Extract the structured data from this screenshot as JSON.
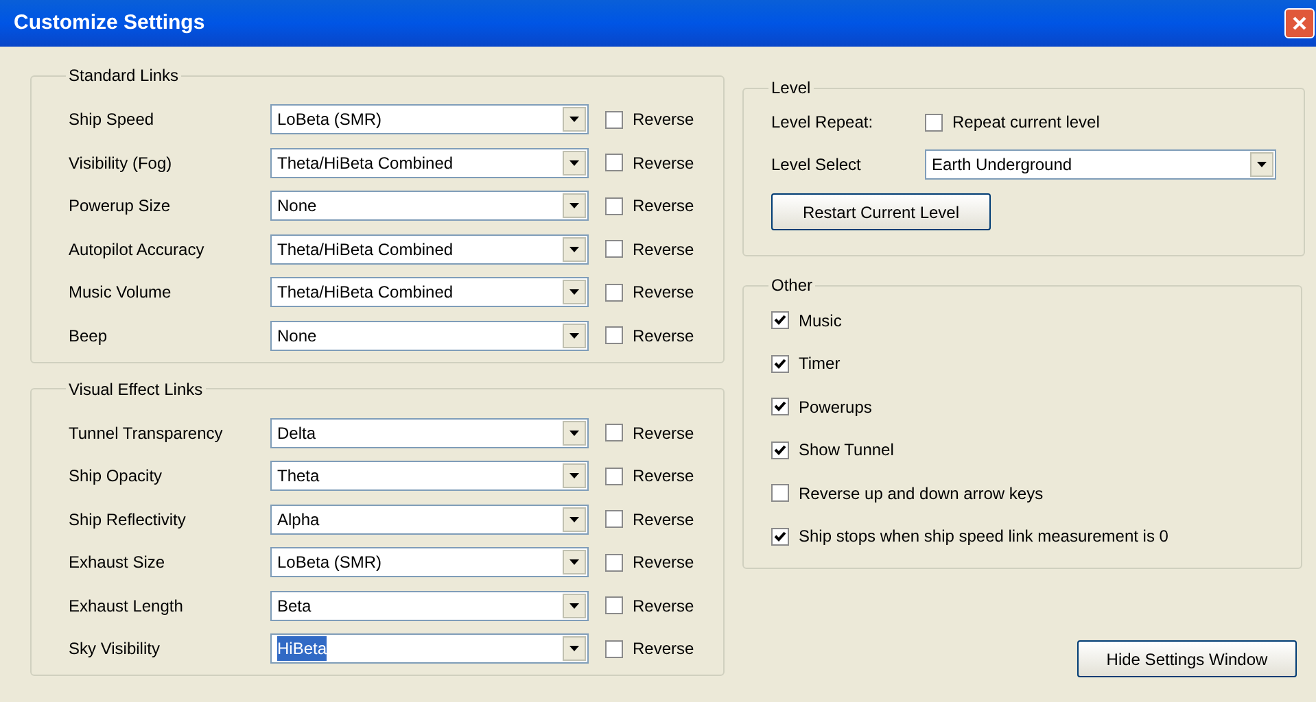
{
  "window": {
    "title": "Customize Settings"
  },
  "groups": [
    {
      "title": "Standard Links",
      "rows": [
        {
          "label": "Ship Speed",
          "value": "LoBeta (SMR)",
          "value_selected": false,
          "reverse_label": "Reverse",
          "reverse": false
        },
        {
          "label": "Visibility (Fog)",
          "value": "Theta/HiBeta Combined",
          "value_selected": false,
          "reverse_label": "Reverse",
          "reverse": false
        },
        {
          "label": "Powerup Size",
          "value": "None",
          "value_selected": false,
          "reverse_label": "Reverse",
          "reverse": false
        },
        {
          "label": "Autopilot Accuracy",
          "value": "Theta/HiBeta Combined",
          "value_selected": false,
          "reverse_label": "Reverse",
          "reverse": false
        },
        {
          "label": "Music Volume",
          "value": "Theta/HiBeta Combined",
          "value_selected": false,
          "reverse_label": "Reverse",
          "reverse": false
        },
        {
          "label": "Beep",
          "value": "None",
          "value_selected": false,
          "reverse_label": "Reverse",
          "reverse": false
        }
      ]
    },
    {
      "title": "Visual Effect Links",
      "rows": [
        {
          "label": "Tunnel Transparency",
          "value": "Delta",
          "value_selected": false,
          "reverse_label": "Reverse",
          "reverse": false
        },
        {
          "label": "Ship Opacity",
          "value": "Theta",
          "value_selected": false,
          "reverse_label": "Reverse",
          "reverse": false
        },
        {
          "label": "Ship Reflectivity",
          "value": "Alpha",
          "value_selected": false,
          "reverse_label": "Reverse",
          "reverse": false
        },
        {
          "label": "Exhaust Size",
          "value": "LoBeta (SMR)",
          "value_selected": false,
          "reverse_label": "Reverse",
          "reverse": false
        },
        {
          "label": "Exhaust Length",
          "value": "Beta",
          "value_selected": false,
          "reverse_label": "Reverse",
          "reverse": false
        },
        {
          "label": "Sky Visibility",
          "value": "HiBeta",
          "value_selected": true,
          "reverse_label": "Reverse",
          "reverse": false
        }
      ]
    }
  ],
  "level": {
    "title": "Level",
    "repeat_label": "Level Repeat:",
    "repeat_checkbox": {
      "label": "Repeat current level",
      "checked": false
    },
    "select_label": "Level Select",
    "select_value": "Earth Underground",
    "restart_button": "Restart Current Level"
  },
  "other": {
    "title": "Other",
    "options": [
      {
        "label": "Music",
        "checked": true
      },
      {
        "label": "Timer",
        "checked": true
      },
      {
        "label": "Powerups",
        "checked": true
      },
      {
        "label": "Show Tunnel",
        "checked": true
      },
      {
        "label": "Reverse up and down arrow keys",
        "checked": false
      },
      {
        "label": "Ship stops when ship speed link measurement is 0",
        "checked": true
      }
    ]
  },
  "hide_button": "Hide Settings Window"
}
